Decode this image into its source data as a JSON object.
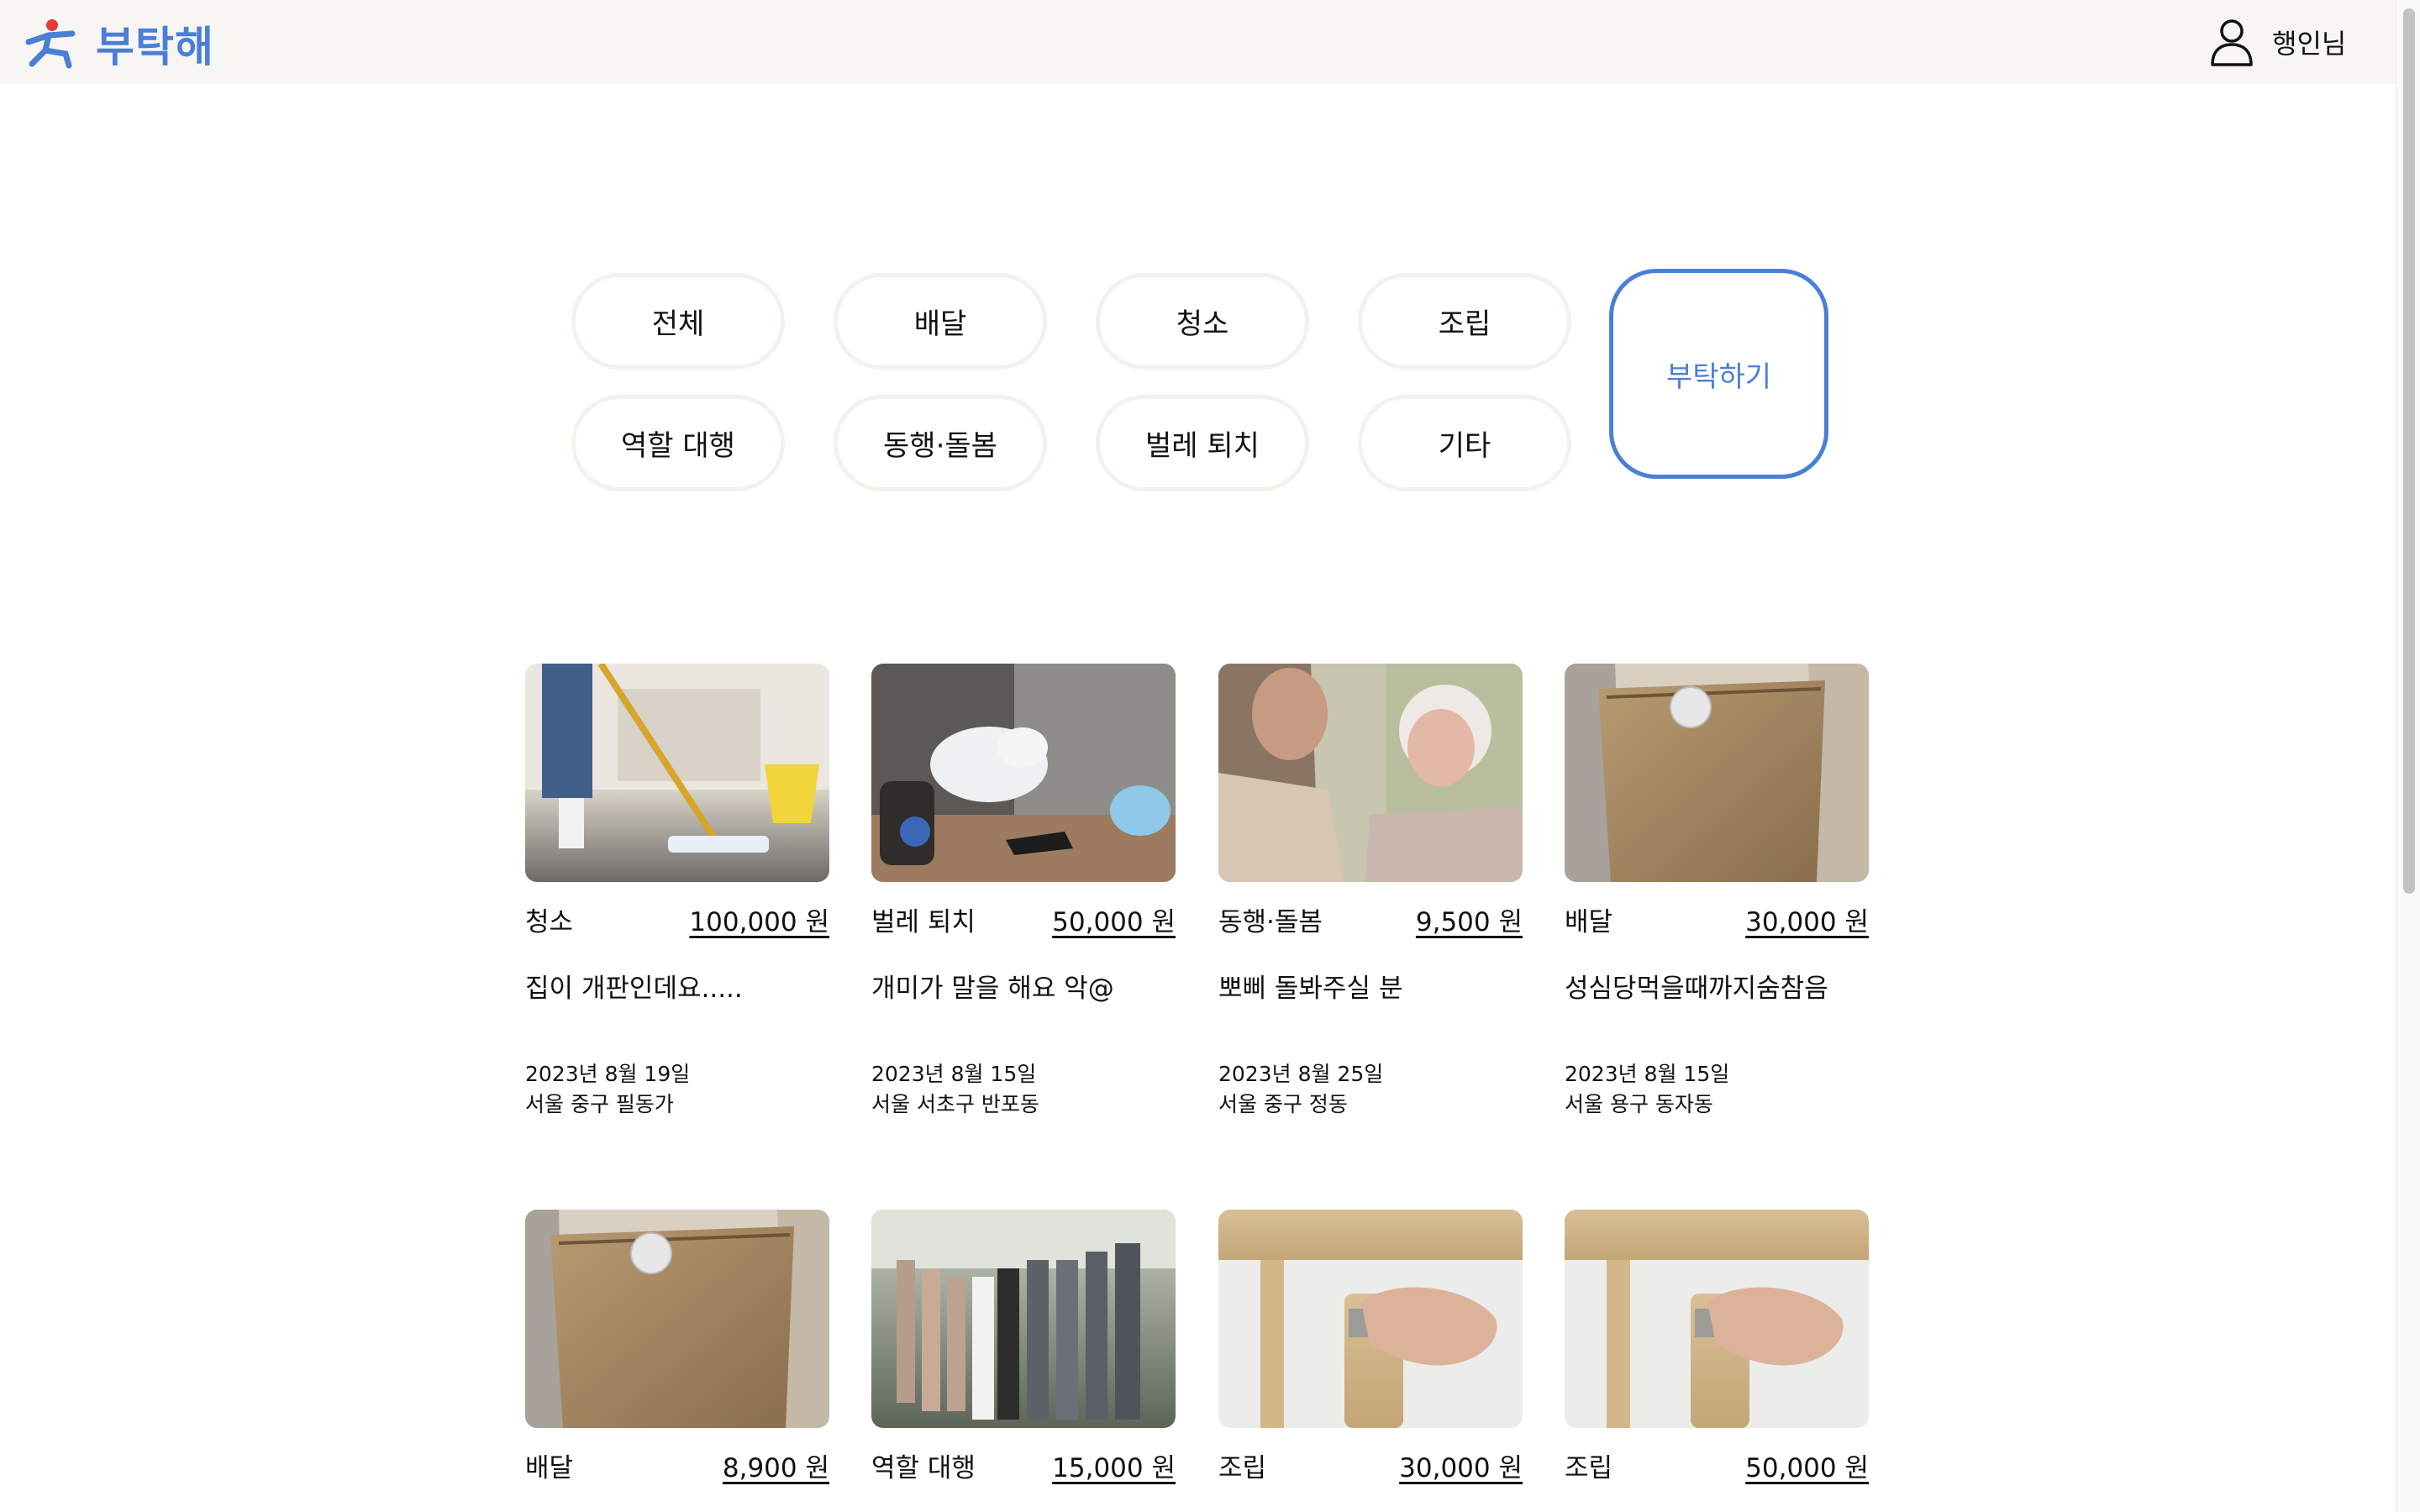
{
  "app": {
    "name": "부탁해"
  },
  "user": {
    "name": "행인님"
  },
  "categories": [
    "전체",
    "배달",
    "청소",
    "조립",
    "역할 대행",
    "동행·돌봄",
    "벌레 퇴치",
    "기타"
  ],
  "request_button": "부탁하기",
  "colors": {
    "brand": "#4a7fd6",
    "header_bg": "#f7f6f3",
    "button_border": "#f4f2ec"
  },
  "posts": [
    {
      "category": "청소",
      "price": "100,000 원",
      "title": "집이 개판인데요.....",
      "date": "2023년 8월 19일",
      "location": "서울 중구 필동가",
      "image": "mop-cleaning-photo"
    },
    {
      "category": "벌레 퇴치",
      "price": "50,000 원",
      "title": "개미가 말을 해요 악@",
      "date": "2023년 8월 15일",
      "location": "서울 서초구 반포동",
      "image": "pest-control-photo"
    },
    {
      "category": "동행·돌봄",
      "price": "9,500 원",
      "title": "뽀삐 돌봐주실 분",
      "date": "2023년 8월 25일",
      "location": "서울 중구 정동",
      "image": "caregiver-elderly-photo"
    },
    {
      "category": "배달",
      "price": "30,000 원",
      "title": "성심당먹을때까지숨참음",
      "date": "2023년 8월 15일",
      "location": "서울 용구 동자동",
      "image": "paper-bag-photo"
    },
    {
      "category": "배달",
      "price": "8,900 원",
      "image": "paper-bag-photo"
    },
    {
      "category": "역할 대행",
      "price": "15,000 원",
      "image": "wedding-party-photo"
    },
    {
      "category": "조립",
      "price": "30,000 원",
      "image": "furniture-leg-photo"
    },
    {
      "category": "조립",
      "price": "50,000 원",
      "image": "furniture-leg-photo"
    }
  ]
}
